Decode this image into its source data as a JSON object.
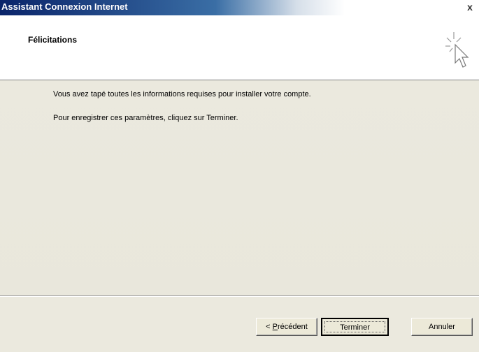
{
  "window": {
    "title": "Assistant Connexion Internet",
    "close_label": "x"
  },
  "header": {
    "title": "Félicitations",
    "icon": "wizard-cursor-icon"
  },
  "body": {
    "line1": "Vous avez tapé toutes les informations requises pour installer votre compte.",
    "line2": "Pour enregistrer ces paramètres, cliquez sur Terminer."
  },
  "buttons": {
    "previous_prefix": "< ",
    "previous_mnemonic": "P",
    "previous_rest": "récédent",
    "finish": "Terminer",
    "cancel": "Annuler"
  },
  "colors": {
    "titlebar_start": "#0a246a",
    "dialog_face": "#ece9d8"
  }
}
